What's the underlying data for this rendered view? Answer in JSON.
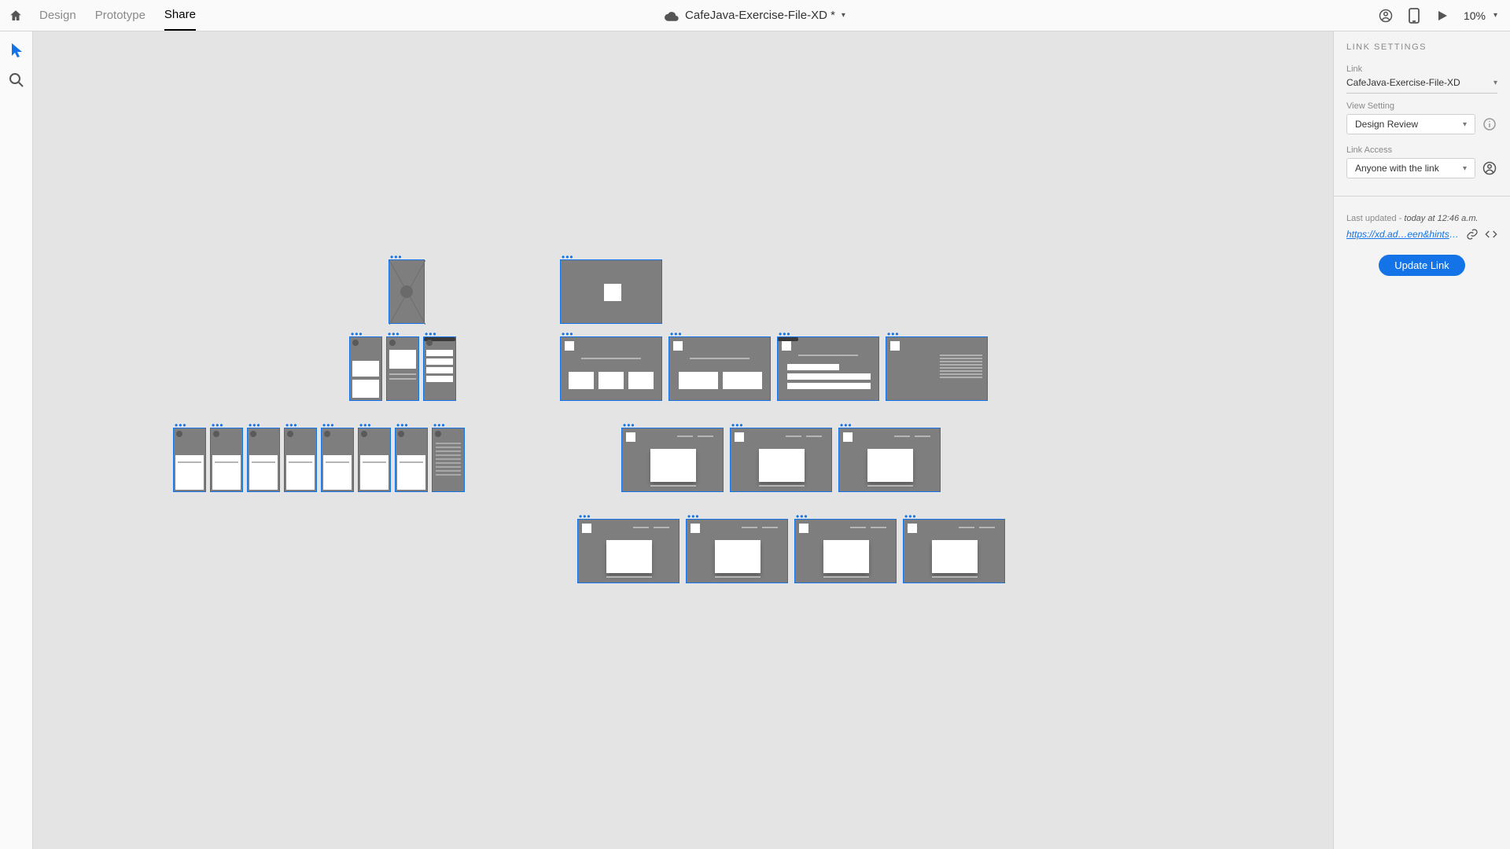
{
  "topbar": {
    "tabs": [
      "Design",
      "Prototype",
      "Share"
    ],
    "active_tab": "Share",
    "document_title": "CafeJava-Exercise-File-XD *",
    "zoom": "10%"
  },
  "left_tools": [
    "pointer",
    "zoom"
  ],
  "right_panel": {
    "heading": "LINK SETTINGS",
    "link_label": "Link",
    "link_name": "CafeJava-Exercise-File-XD",
    "view_setting_label": "View Setting",
    "view_setting_value": "Design Review",
    "link_access_label": "Link Access",
    "link_access_value": "Anyone with the link",
    "last_updated_prefix": "Last updated - ",
    "last_updated_time": "today at 12:46 a.m.",
    "share_url_display": "https://xd.ad…een&hints=off",
    "update_button": "Update Link"
  },
  "colors": {
    "selection_blue": "#1473e6",
    "artboard_gray": "#7e7e7e"
  }
}
